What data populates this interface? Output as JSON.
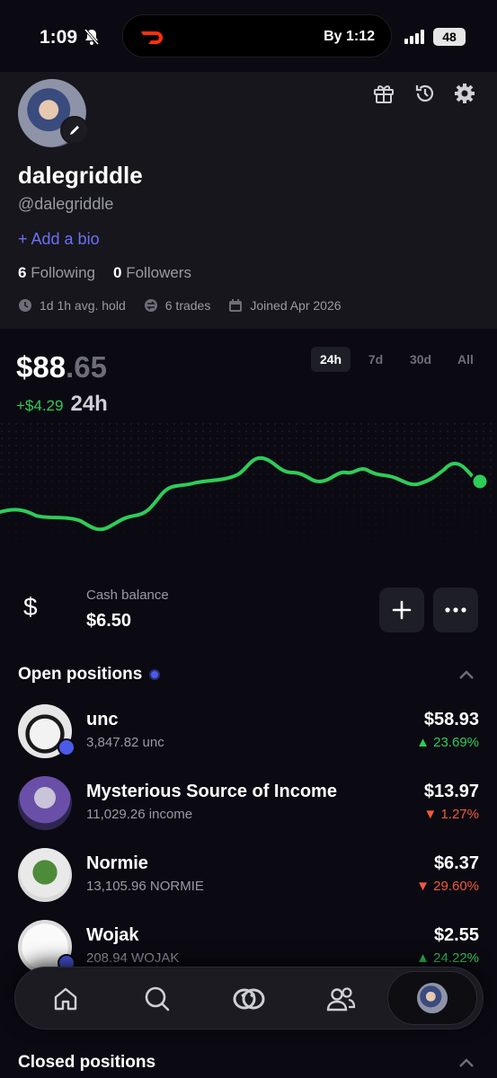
{
  "status_bar": {
    "time": "1:09",
    "eta": "By 1:12",
    "battery": "48"
  },
  "profile": {
    "username": "dalegriddle",
    "handle": "@dalegriddle",
    "add_bio": "+ Add a bio",
    "following_count": "6",
    "following_label": "Following",
    "followers_count": "0",
    "followers_label": "Followers",
    "avg_hold": "1d 1h avg. hold",
    "trades": "6 trades",
    "joined": "Joined Apr 2026"
  },
  "portfolio": {
    "value_main": "$88",
    "value_cents": ".65",
    "change": "+$4.29",
    "period": "24h",
    "ranges": [
      "24h",
      "7d",
      "30d",
      "All"
    ],
    "active_range": "24h"
  },
  "cash": {
    "icon": "$",
    "label": "Cash balance",
    "value": "$6.50"
  },
  "open_positions": {
    "title": "Open positions",
    "items": [
      {
        "name": "unc",
        "amount": "3,847.82 unc",
        "value": "$58.93",
        "change": "23.69%",
        "direction": "up"
      },
      {
        "name": "Mysterious Source of Income",
        "amount": "11,029.26 income",
        "value": "$13.97",
        "change": "1.27%",
        "direction": "down"
      },
      {
        "name": "Normie",
        "amount": "13,105.96 NORMIE",
        "value": "$6.37",
        "change": "29.60%",
        "direction": "down"
      },
      {
        "name": "Wojak",
        "amount": "208.94 WOJAK",
        "value": "$2.55",
        "change": "24.22%",
        "direction": "up"
      }
    ]
  },
  "closed_positions": {
    "title": "Closed positions"
  },
  "colors": {
    "accent": "#6e6ff6",
    "up": "#2ecc59",
    "down": "#ef5a3a",
    "background": "#0b0a12",
    "card": "#16161c"
  },
  "icons": {
    "gift": "gift-icon",
    "history": "history-icon",
    "settings": "gear-icon",
    "nav": [
      "home-icon",
      "search-icon",
      "coins-icon",
      "friends-icon",
      "profile-avatar"
    ]
  }
}
